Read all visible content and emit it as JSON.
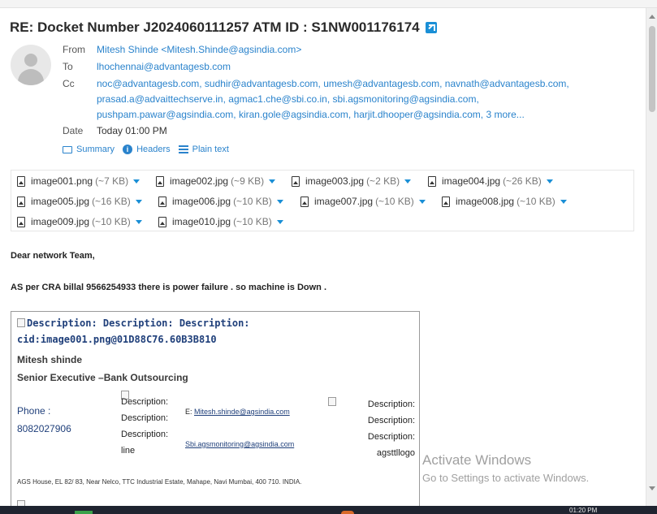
{
  "subject": "RE: Docket Number J2024060111257 ATM ID : S1NW001176174",
  "header": {
    "from_label": "From",
    "from_value": "Mitesh Shinde <Mitesh.Shinde@agsindia.com>",
    "to_label": "To",
    "to_value": "lhochennai@advantagesb.com",
    "cc_label": "Cc",
    "cc_lines": [
      "noc@advantagesb.com, sudhir@advantagesb.com, umesh@advantagesb.com, navnath@advantagesb.com,",
      "prasad.a@advaittechserve.in, agmac1.che@sbi.co.in, sbi.agsmonitoring@agsindia.com,",
      "pushpam.pawar@agsindia.com, kiran.gole@agsindia.com, harjit.dhooper@agsindia.com, 3 more..."
    ],
    "date_label": "Date",
    "date_value": "Today 01:00 PM"
  },
  "view_links": {
    "summary": "Summary",
    "headers": "Headers",
    "plain_text": "Plain text"
  },
  "attachments": [
    {
      "name": "image001.png",
      "size": "(~7 KB)"
    },
    {
      "name": "image002.jpg",
      "size": "(~9 KB)"
    },
    {
      "name": "image003.jpg",
      "size": "(~2 KB)"
    },
    {
      "name": "image004.jpg",
      "size": "(~26 KB)"
    },
    {
      "name": "image005.jpg",
      "size": "(~16 KB)"
    },
    {
      "name": "image006.jpg",
      "size": "(~10 KB)"
    },
    {
      "name": "image007.jpg",
      "size": "(~10 KB)"
    },
    {
      "name": "image008.jpg",
      "size": "(~10 KB)"
    },
    {
      "name": "image009.jpg",
      "size": "(~10 KB)"
    },
    {
      "name": "image010.jpg",
      "size": "(~10 KB)"
    }
  ],
  "body": {
    "greeting": "Dear network Team,",
    "message": "AS per CRA billal 9566254933 there is power failure . so machine is Down ."
  },
  "signature": {
    "broken_image_line1": "Description: Description: Description:",
    "broken_image_line2": "cid:image001.png@01D88C76.60B3B810",
    "name": "Mitesh shinde",
    "title": "Senior Executive –Bank Outsourcing",
    "phone_label": "Phone :",
    "phone_number": "8082027906",
    "desc_left": [
      "Description:",
      "Description:",
      "Description:",
      "line"
    ],
    "email_prefix": "E: ",
    "email": "Mitesh.shinde@agsindia.com",
    "email2": "Sbi.agsmonitoring@agsindia.com",
    "desc_right": [
      "Description:",
      "Description:",
      "Description:",
      "agsttllogo"
    ],
    "address": "AGS House, EL 82/ 83, Near Nelco, TTC Industrial Estate, Mahape, Navi Mumbai, 400 710. INDIA."
  },
  "watermark": {
    "line1": "Activate Windows",
    "line2": "Go to Settings to activate Windows."
  },
  "taskbar": {
    "time": "01:20 PM"
  }
}
